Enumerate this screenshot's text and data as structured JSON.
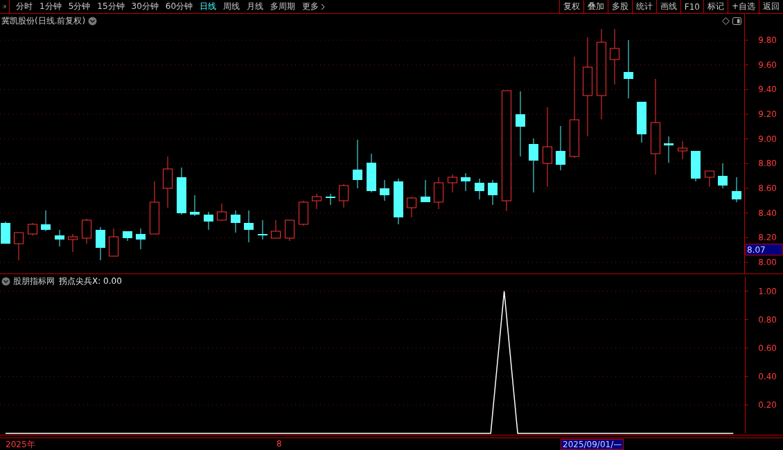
{
  "toolbar": {
    "periods": [
      {
        "label": "分时",
        "selected": false
      },
      {
        "label": "1分钟",
        "selected": false
      },
      {
        "label": "5分钟",
        "selected": false
      },
      {
        "label": "15分钟",
        "selected": false
      },
      {
        "label": "30分钟",
        "selected": false
      },
      {
        "label": "60分钟",
        "selected": false
      },
      {
        "label": "日线",
        "selected": true
      },
      {
        "label": "周线",
        "selected": false
      },
      {
        "label": "月线",
        "selected": false
      },
      {
        "label": "多周期",
        "selected": false
      },
      {
        "label": "更多",
        "selected": false
      }
    ],
    "actions": [
      "复权",
      "叠加",
      "多股",
      "统计",
      "画线",
      "F10",
      "标记",
      "+自选",
      "返回"
    ]
  },
  "main_chart": {
    "title": "冀凯股份(日线.前复权)",
    "price_axis": [
      "9.80",
      "9.60",
      "9.40",
      "9.20",
      "9.00",
      "8.80",
      "8.60",
      "8.40",
      "8.20",
      "8.00"
    ],
    "price_marker": "8.07"
  },
  "indicator": {
    "source": "股朋指标网",
    "reading": "拐点尖兵X: 0.00",
    "chart_data": {
      "type": "line",
      "ylim": [
        0,
        1.1
      ],
      "grid": true,
      "yticks": [
        {
          "value": 0.2,
          "label": "0.20"
        },
        {
          "value": 0.4,
          "label": "0.40"
        },
        {
          "value": 0.6,
          "label": "0.60"
        },
        {
          "value": 0.8,
          "label": "0.80"
        },
        {
          "value": 1.0,
          "label": "1.00"
        }
      ],
      "series": [
        {
          "color": "#ffffff",
          "values": [
            0,
            0,
            0,
            0,
            0,
            0,
            0,
            0,
            0,
            0,
            0,
            0,
            0,
            0,
            0,
            0,
            0,
            0,
            0,
            0,
            0,
            0,
            0,
            0,
            0,
            0,
            0,
            0,
            0,
            0,
            0,
            0,
            0,
            0,
            0,
            0,
            0,
            1,
            0,
            0,
            0,
            0,
            0,
            0,
            0,
            0,
            0,
            0,
            0,
            0,
            0,
            0,
            0,
            0,
            0
          ]
        }
      ]
    }
  },
  "time_axis": {
    "start": "2025年",
    "month": "8",
    "cursor_date": "2025/09/01/—"
  }
}
